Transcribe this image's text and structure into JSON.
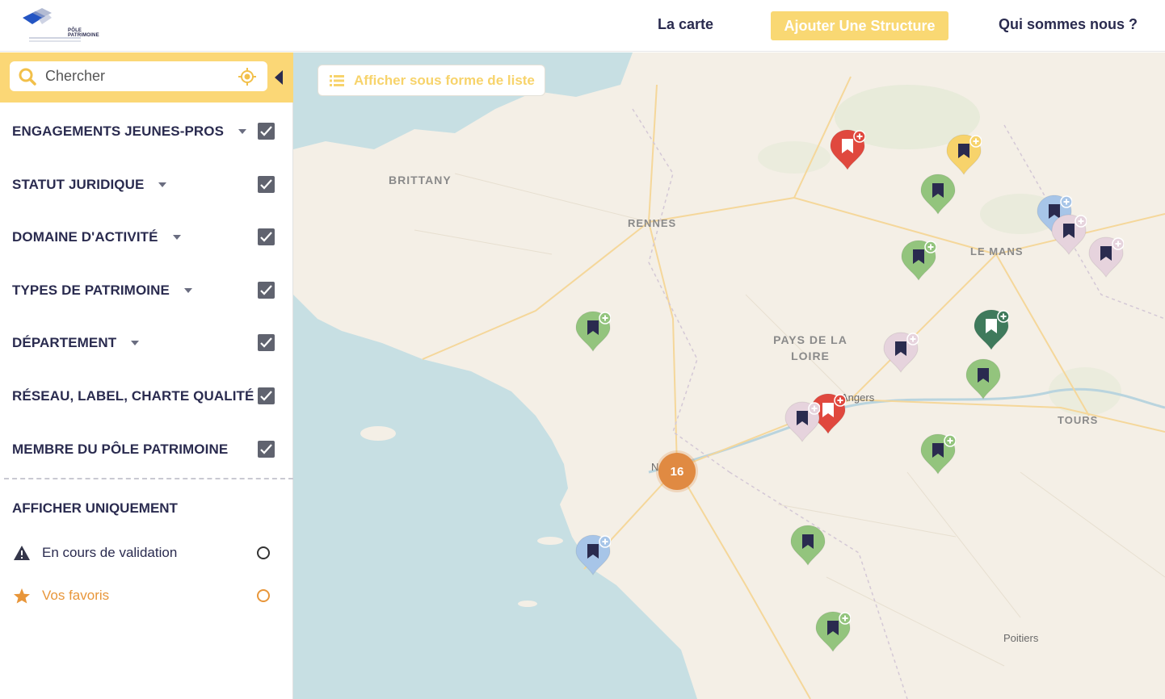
{
  "header": {
    "logo_line1": "PÔLE",
    "logo_line2": "PATRIMOINE",
    "nav": [
      {
        "label": "La carte"
      },
      {
        "label": "Ajouter Une Structure"
      },
      {
        "label": "Qui sommes nous ?"
      }
    ]
  },
  "sidebar": {
    "search": {
      "placeholder": "Chercher"
    },
    "filters": [
      {
        "label": "ENGAGEMENTS JEUNES-PROS",
        "checked": true
      },
      {
        "label": "STATUT JURIDIQUE",
        "checked": true
      },
      {
        "label": "DOMAINE D'ACTIVITÉ",
        "checked": true
      },
      {
        "label": "TYPES DE PATRIMOINE",
        "checked": true
      },
      {
        "label": "DÉPARTEMENT",
        "checked": true
      },
      {
        "label": "RÉSEAU, LABEL, CHARTE QUALITÉ",
        "checked": true
      },
      {
        "label": "MEMBRE DU PÔLE PATRIMOINE",
        "checked": true
      }
    ],
    "show_only": {
      "title": "AFFICHER UNIQUEMENT",
      "options": [
        {
          "label": "En cours de validation",
          "icon": "warning-icon",
          "color": "#2a2b4f"
        },
        {
          "label": "Vos favoris",
          "icon": "star-icon",
          "color": "#e8963a"
        }
      ]
    }
  },
  "map": {
    "list_button": "Afficher sous forme de liste",
    "places": {
      "brittany": "BRITTANY",
      "rennes": "RENNES",
      "le_mans": "LE MANS",
      "pays_line1": "PAYS DE LA",
      "pays_line2": "LOIRE",
      "angers": "Angers",
      "tours": "TOURS",
      "poitiers": "Poitiers",
      "nantes_partial": "N"
    },
    "cluster_count": "16"
  },
  "colors": {
    "accent": "#fbd776",
    "navy": "#2a2b4f",
    "marker_green": "#93c47d",
    "marker_red": "#e0483e",
    "marker_yellow": "#f7d36b",
    "marker_blue": "#a7c5e8",
    "marker_pink": "#e6d3dd",
    "marker_dark_green": "#3f7a5c",
    "cluster_orange": "#e08a42"
  }
}
